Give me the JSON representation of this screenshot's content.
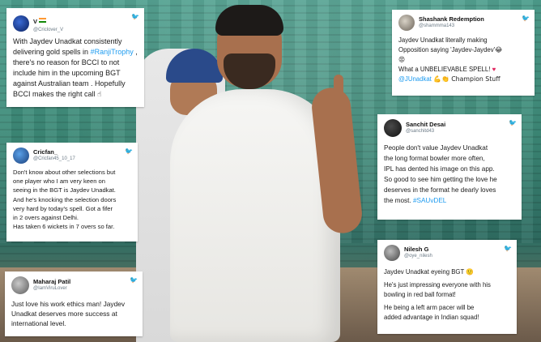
{
  "tweets": {
    "t1": {
      "name": "V",
      "handle": "@Criclover_V",
      "lines": [
        "With Jaydev Unadkat consistently",
        "there's no reason for BCCI to not",
        "include him in the upcoming BGT",
        "against Australian team . Hopefully",
        "BCCI makes the right call"
      ],
      "line2_prefix": "delivering gold spells in ",
      "hashtag": "#RanjiTrophy",
      "line2_suffix": " ,",
      "emoji_end": "☝"
    },
    "t2": {
      "name": "Cricfan_",
      "handle": "@Cricfan45_10_17",
      "lines": [
        "Don't know about other selections but",
        "one player who I am very keen on",
        "seeing in the BGT is Jaydev Unadkat.",
        "And he's knocking the selection doors",
        "very hard by today's spell. Got a fifer",
        "in 2 overs against Delhi.",
        "Has taken 6 wickets in 7 overs so far."
      ]
    },
    "t3": {
      "name": "Maharaj Patil",
      "handle": "@IamViruLover",
      "lines": [
        "Just love his work ethics man! Jaydev",
        "Unadkat deserves more success at",
        "international level."
      ]
    },
    "t4": {
      "name": "Shashank Redemption",
      "handle": "@shammma143",
      "line1": "Jaydev Unadkat literally making",
      "line2": "Opposition saying 'Jaydev-Jaydev'",
      "emoji_a": "😂",
      "emoji_b": "😡",
      "line3": "What a UNBELIEVABLE SPELL! ",
      "heart": "♥",
      "mention": "@JUnadkat",
      "line4_suffix": " 💪👏 Champion Stuff"
    },
    "t5": {
      "name": "Sanchit Desai",
      "handle": "@sanchitd43",
      "lines": [
        "People don't value Jaydev Unadkat",
        "the long format bowler more often,",
        "IPL has dented his image on this app.",
        "So good to see him getting the love he",
        "deserves in the format he dearly loves"
      ],
      "last_prefix": "the most. ",
      "hashtag": "#SAUvDEL"
    },
    "t6": {
      "name": "Nilesh G",
      "handle": "@oye_nilesh",
      "line1": "Jaydev Unadkat eyeing BGT ",
      "emoji": "🙂",
      "p2": [
        "He's just impressing everyone with his",
        "bowling in red ball format!"
      ],
      "p3": [
        "He being a left arm pacer will be",
        "added advantage in Indian squad!"
      ]
    }
  },
  "colors": {
    "link": "#1d9bf0",
    "card_bg": "#ffffff",
    "text": "#1b1b1b",
    "handle": "#6b7a86"
  },
  "icons": [
    "twitter-bird-icon",
    "india-flag-icon",
    "avatar-icon"
  ]
}
